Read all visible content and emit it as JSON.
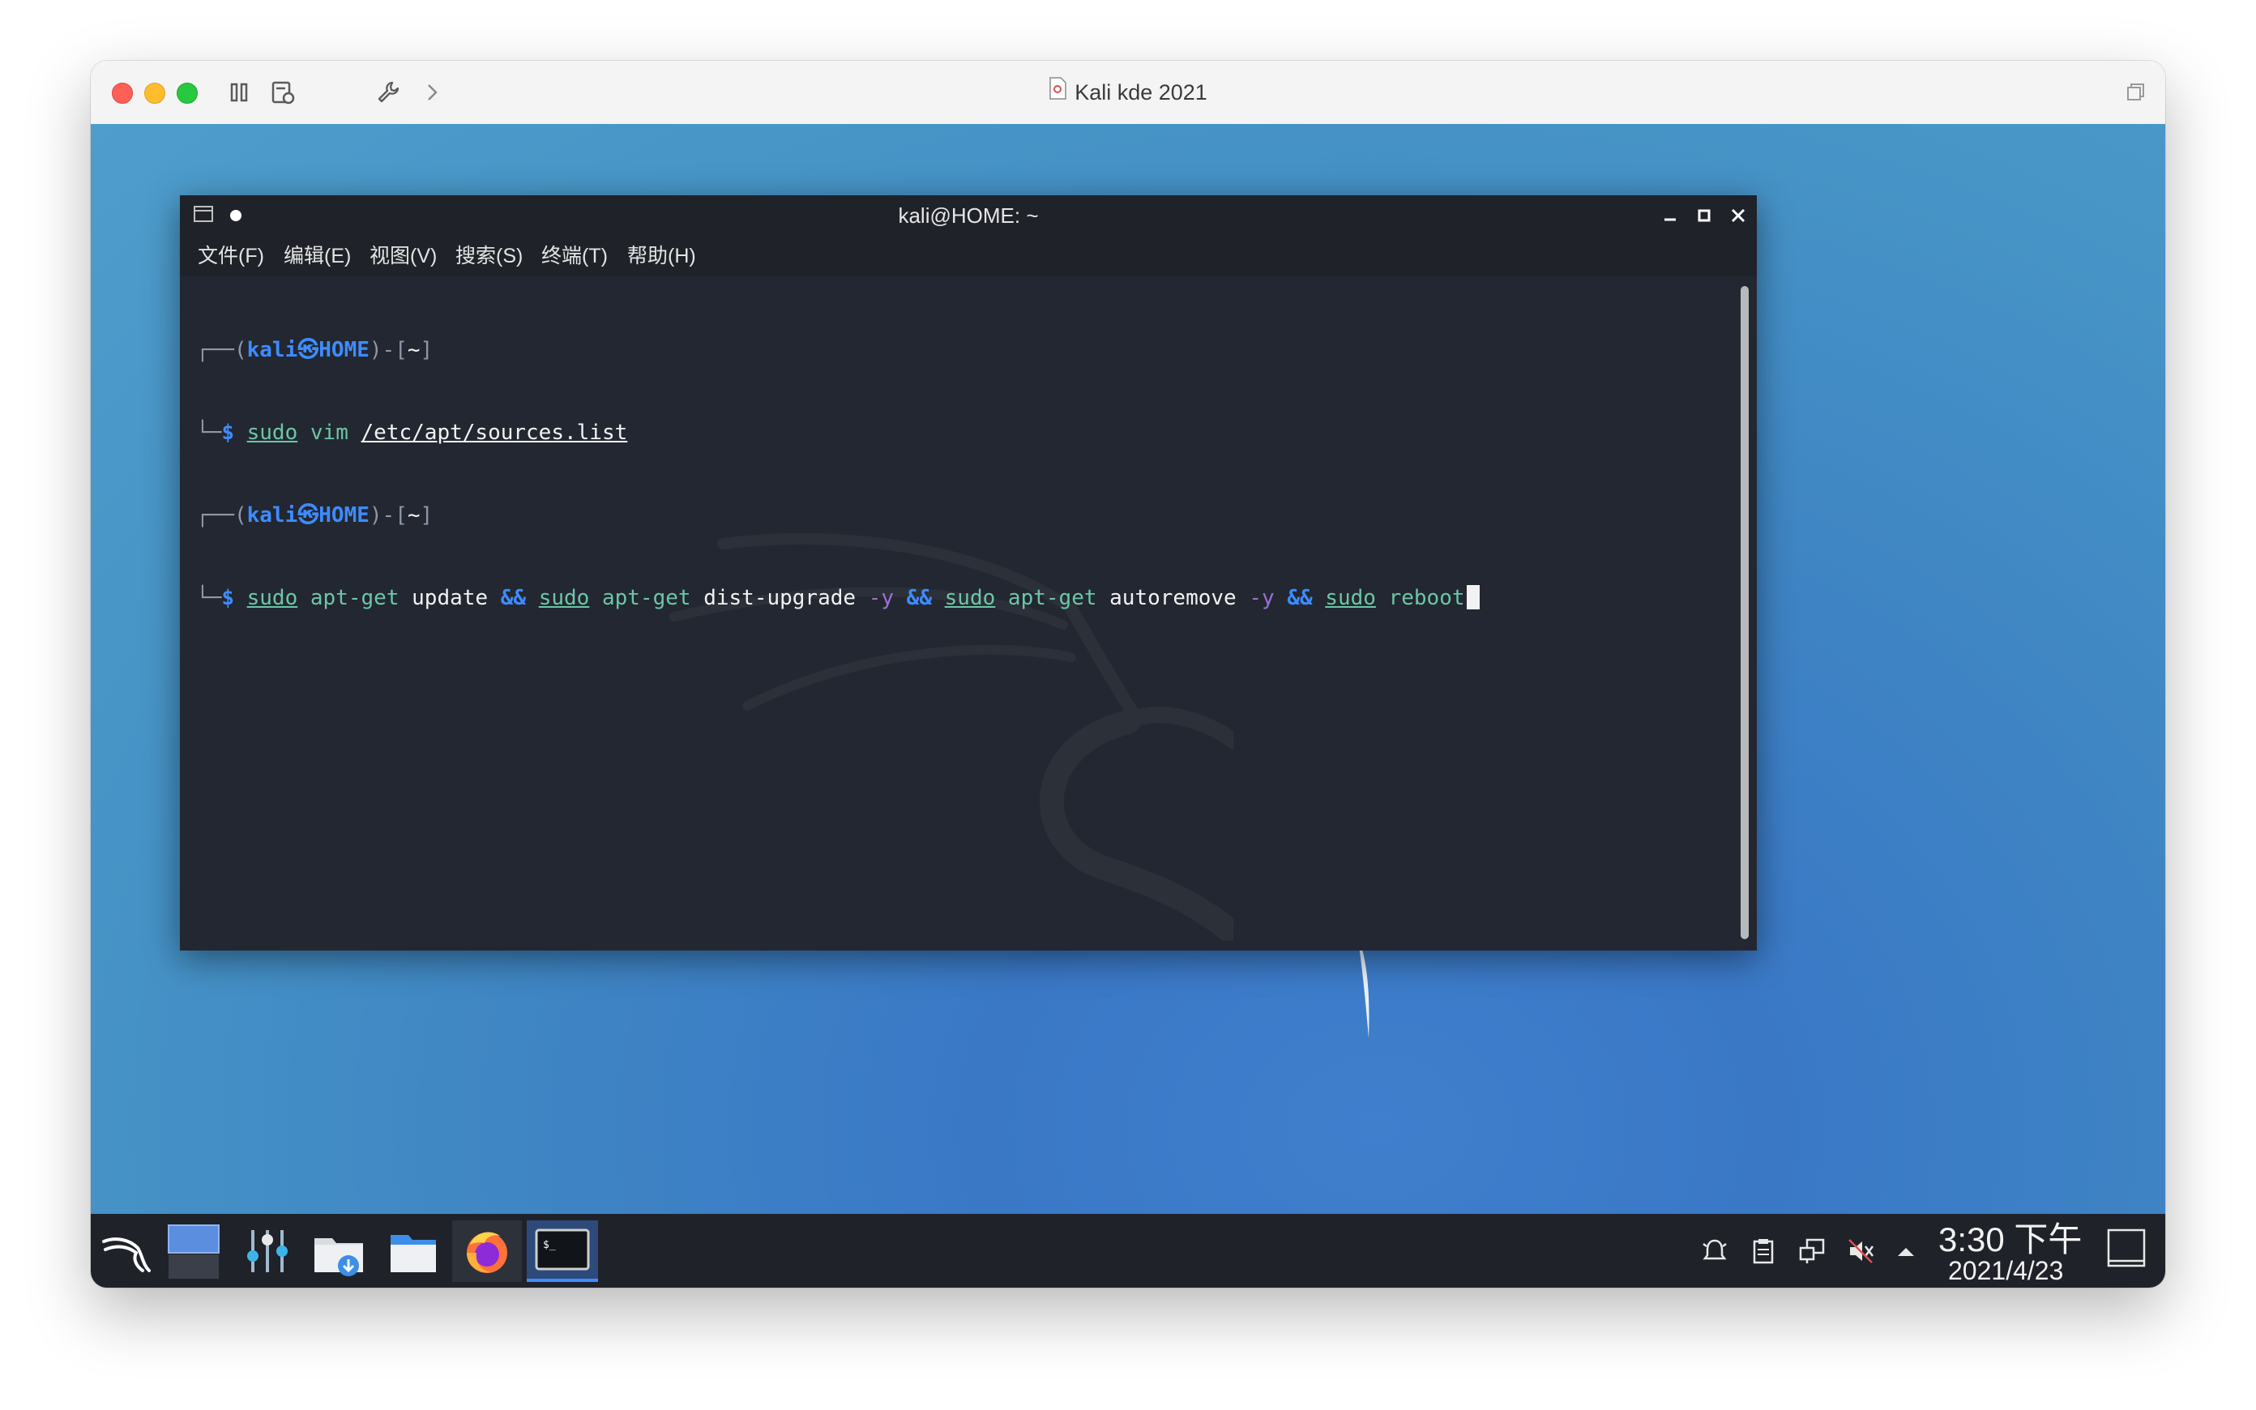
{
  "vm": {
    "title": "Kali kde 2021"
  },
  "terminal": {
    "title": "kali@HOME: ~",
    "menu": [
      "文件(F)",
      "编辑(E)",
      "视图(V)",
      "搜索(S)",
      "终端(T)",
      "帮助(H)"
    ],
    "prompt_user": "kali",
    "prompt_host": "HOME",
    "prompt_dir": "~",
    "cmd1": {
      "sudo": "sudo",
      "prog": "vim",
      "arg": "/etc/apt/sources.list"
    },
    "cmd2": {
      "sudo": "sudo",
      "apt": "apt-get",
      "update": "update",
      "and": "&&",
      "dist_upgrade": "dist-upgrade",
      "flag": "-y",
      "autoremove": "autoremove",
      "reboot": "reboot"
    }
  },
  "taskbar": {
    "apps": [
      "kali-menu-icon",
      "desktop-pager-icon",
      "settings-mixer-icon",
      "downloads-icon",
      "file-manager-icon",
      "firefox-icon",
      "terminal-icon"
    ],
    "clock_time": "3:30 下午",
    "clock_date": "2021/4/23"
  },
  "colors": {
    "prompt_blue": "#3d8cff",
    "command_green": "#6cc6a6",
    "flag_purple": "#9e6fd6",
    "desktop_blue": "#4290c9"
  }
}
